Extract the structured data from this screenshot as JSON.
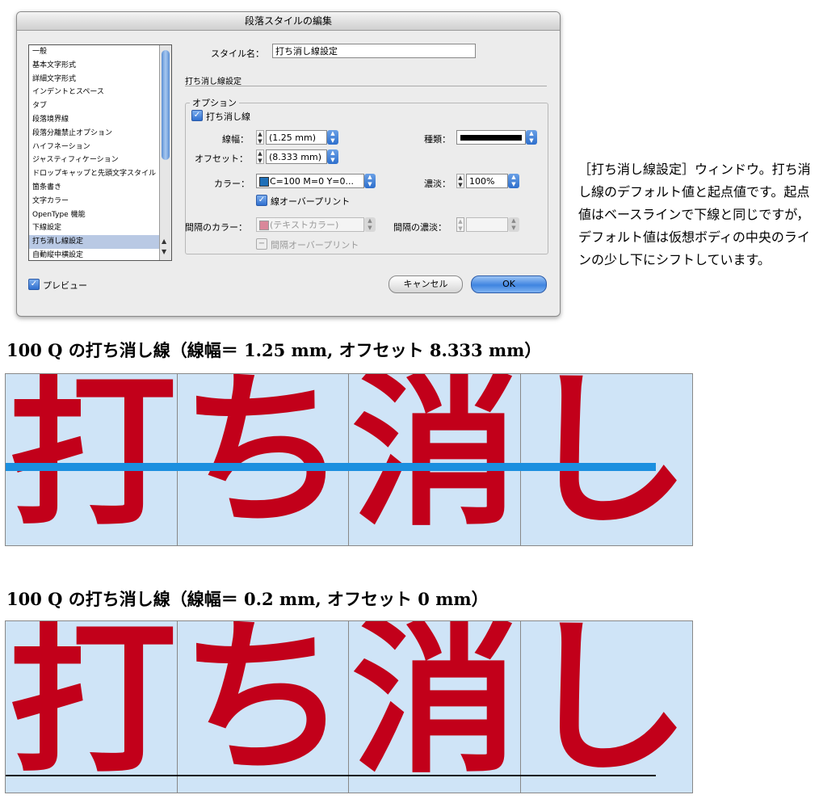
{
  "dialog": {
    "title": "段落スタイルの編集",
    "categories": [
      "一般",
      "基本文字形式",
      "詳細文字形式",
      "インデントとスペース",
      "タブ",
      "段落境界線",
      "段落分離禁止オプション",
      "ハイフネーション",
      "ジャスティフィケーション",
      "ドロップキャップと先頭文字スタイル",
      "箇条書き",
      "文字カラー",
      "OpenType 機能",
      "下線設定",
      "打ち消し線設定",
      "自動縦中横設定"
    ],
    "selected_category": "打ち消し線設定",
    "style_name_label": "スタイル名：",
    "style_name_value": "打ち消し線設定",
    "section_title": "打ち消し線設定",
    "options_label": "オプション",
    "strike_checkbox_label": "打ち消し線",
    "weight_label": "線幅：",
    "weight_value": "(1.25 mm)",
    "type_label": "種類：",
    "offset_label": "オフセット：",
    "offset_value": "(8.333 mm)",
    "color_label": "カラー：",
    "color_value": "C=100 M=0 Y=0...",
    "tint_label": "濃淡：",
    "tint_value": "100%",
    "overprint_label": "線オーバープリント",
    "gap_color_label": "間隔のカラー：",
    "gap_color_value": "(テキストカラー)",
    "gap_tint_label": "間隔の濃淡：",
    "gap_overprint_label": "間隔オーバープリント",
    "preview_label": "プレビュー",
    "cancel_label": "キャンセル",
    "ok_label": "OK"
  },
  "caption": "［打ち消し線設定］ウィンドウ。打ち消し線のデフォルト値と起点値です。起点値はベースラインで下線と同じですが，デフォルト値は仮想ボディの中央のラインの少し下にシフトしています。",
  "demo1": {
    "heading": "100 Q の打ち消し線（線幅＝ 1.25 mm, オフセット 8.333 mm）",
    "chars": [
      "打",
      "ち",
      "消",
      "し"
    ]
  },
  "demo2": {
    "heading": "100 Q の打ち消し線（線幅＝ 0.2 mm, オフセット 0 mm）",
    "chars": [
      "打",
      "ち",
      "消",
      "し"
    ]
  },
  "colors": {
    "glyph_red": "#c2001a",
    "panel_bg": "#cfe4f7",
    "strike_blue": "#1b8fdf",
    "color_swatch": "#1f6fb8",
    "gap_swatch": "#d9889a"
  }
}
